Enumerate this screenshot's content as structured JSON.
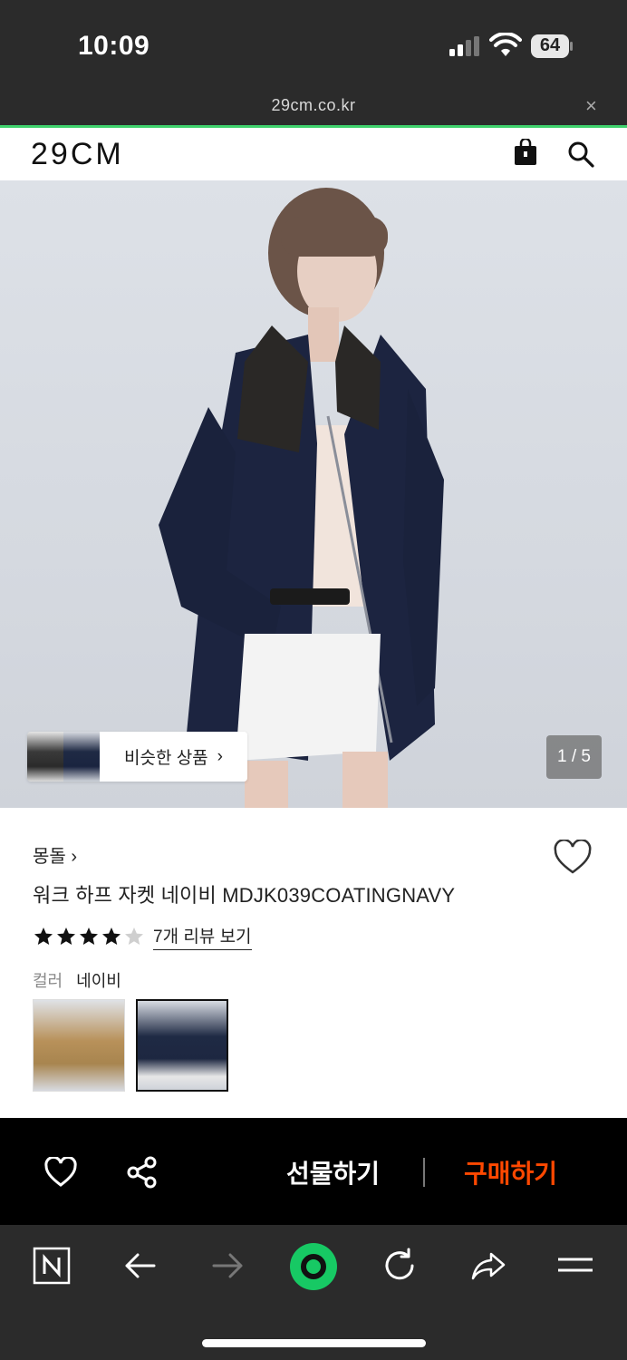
{
  "status_bar": {
    "time": "10:09",
    "battery": "64"
  },
  "browser": {
    "url": "29cm.co.kr",
    "close_glyph": "×"
  },
  "site": {
    "logo": "29CM"
  },
  "hero": {
    "similar_label": "비슷한 상품",
    "chevron": "›",
    "page_indicator": "1 / 5"
  },
  "product": {
    "brand": "몽돌",
    "brand_chevron": "›",
    "name": "워크 하프 자켓 네이비 MDJK039COATINGNAVY",
    "rating": 4,
    "rating_max": 5,
    "review_link": "7개 리뷰 보기",
    "color_label": "컬러",
    "color_value": "네이비"
  },
  "actions": {
    "gift": "선물하기",
    "buy": "구매하기"
  },
  "colors": {
    "buy": "#ff4800",
    "progress": "#3fd16c",
    "green_button": "#17c964"
  },
  "icons": [
    "bag-icon",
    "search-icon",
    "heart-icon",
    "share-icon",
    "n-icon",
    "back-icon",
    "forward-icon",
    "green-home-icon",
    "reload-icon",
    "share-arrow-icon",
    "menu-icon"
  ]
}
